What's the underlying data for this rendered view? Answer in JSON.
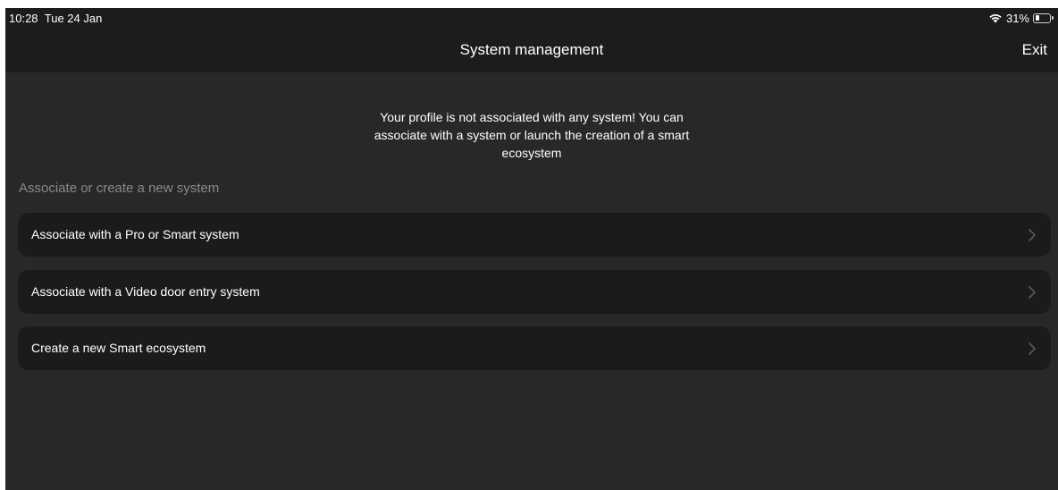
{
  "status_bar": {
    "time": "10:28",
    "date": "Tue 24 Jan",
    "battery_percent_label": "31%",
    "battery_level": 0.31,
    "icons": [
      "wifi-icon",
      "battery-icon"
    ]
  },
  "nav": {
    "title": "System management",
    "exit_label": "Exit"
  },
  "message": "Your profile is not associated with any system! You can associate with a system or launch the creation of a smart ecosystem",
  "section_header": "Associate or create a new system",
  "options": [
    {
      "label": "Associate with a Pro or Smart system",
      "icon": "chevron-right-icon"
    },
    {
      "label": "Associate with a Video door entry system",
      "icon": "chevron-right-icon"
    },
    {
      "label": "Create a new Smart ecosystem",
      "icon": "chevron-right-icon"
    }
  ],
  "colors": {
    "background": "#282828",
    "bar_background": "#1c1c1c",
    "row_background": "#1b1b1b",
    "text": "#ffffff",
    "secondary_text": "#8a8a8a",
    "chevron": "#5a5a5a"
  }
}
